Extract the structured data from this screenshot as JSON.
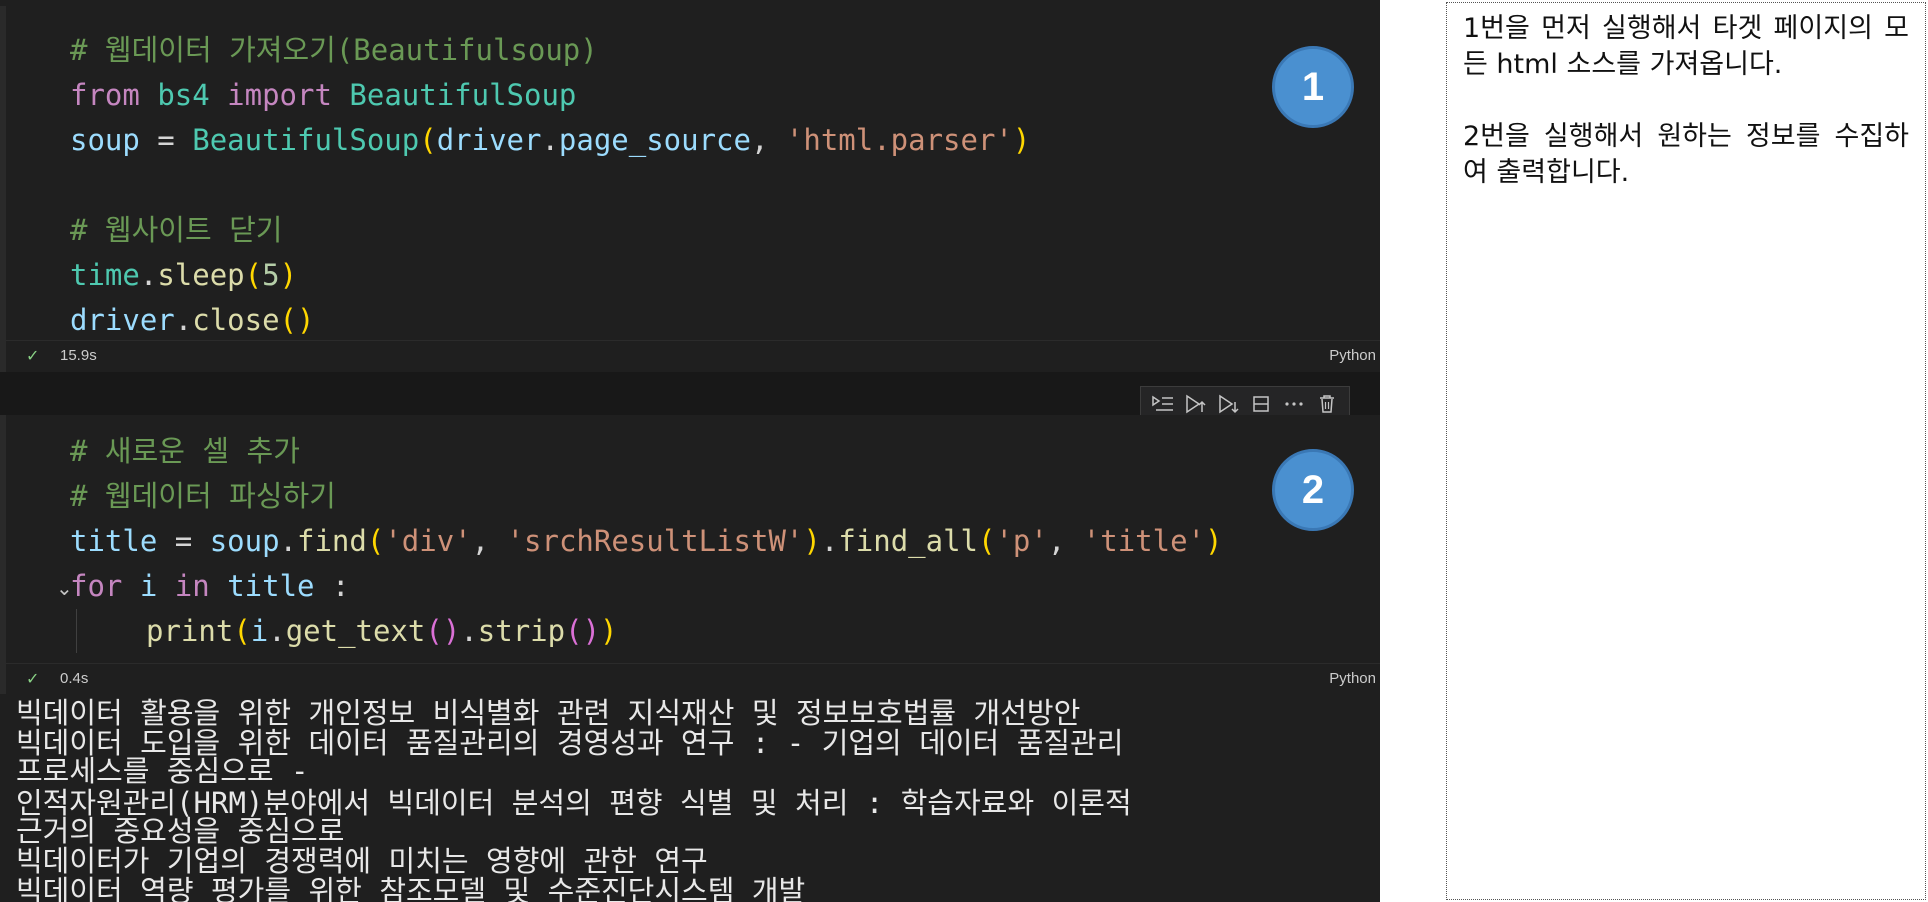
{
  "cells": [
    {
      "badge": "1",
      "comment1": "# 웹데이터 가져오기(Beautifulsoup)",
      "line2": {
        "kw_from": "from",
        "mod": "bs4",
        "kw_import": "import",
        "cls": "BeautifulSoup"
      },
      "line3": {
        "var": "soup",
        "eq": " = ",
        "cls": "BeautifulSoup",
        "arg1": "driver",
        "attr": "page_source",
        "sep": ", ",
        "str": "'html.parser'"
      },
      "comment2": "# 웹사이트 닫기",
      "line5": {
        "obj": "time",
        "fn": "sleep",
        "num": "5"
      },
      "line6": {
        "obj": "driver",
        "fn": "close"
      },
      "status_time": "15.9s",
      "language": "Python"
    },
    {
      "badge": "2",
      "comment1": "# 새로운 셀 추가",
      "comment2": "# 웹데이터 파싱하기",
      "line3": {
        "var": "title",
        "eq": " = ",
        "obj": "soup",
        "fn1": "find",
        "s1": "'div'",
        "s2": "'srchResultListW'",
        "fn2": "find_all",
        "s3": "'p'",
        "s4": "'title'"
      },
      "line4": {
        "kw_for": "for",
        "var": "i",
        "kw_in": "in",
        "iter": "title",
        "colon": " :"
      },
      "line5": {
        "fn": "print",
        "var": "i",
        "m1": "get_text",
        "m2": "strip"
      },
      "status_time": "0.4s",
      "language": "Python"
    }
  ],
  "toolbar_icons": [
    "run-by-line-icon",
    "execute-above-icon",
    "execute-below-icon",
    "split-cell-icon",
    "more-actions-icon",
    "delete-cell-icon"
  ],
  "output_lines": [
    "빅데이터 활용을 위한 개인정보 비식별화 관련 지식재산 및 정보보호법률 개선방안",
    "빅데이터 도입을 위한 데이터 품질관리의 경영성과 연구 : - 기업의 데이터 품질관리",
    "프로세스를 중심으로 -",
    "인적자원관리(HRM)분야에서 빅데이터 분석의 편향 식별 및 처리 : 학습자료와 이론적",
    "근거의 중요성을 중심으로",
    "빅데이터가 기업의 경쟁력에 미치는 영향에 관한 연구",
    "빅데이터 역량 평가를 위한 참조모델 및 수준진단시스템 개발"
  ],
  "notes": {
    "para1": "1번을 먼저 실행해서 타겟 페이지의 모든 html 소스를 가져옵니다.",
    "para2": "2번을 실행해서 원하는 정보를 수집하여 출력합니다."
  },
  "colors": {
    "editor_bg": "#1f1f1f",
    "badge": "#4a90d0",
    "keyword": "#c586c0",
    "class": "#4ec9b0",
    "string": "#ce9178",
    "comment": "#6a9955"
  }
}
